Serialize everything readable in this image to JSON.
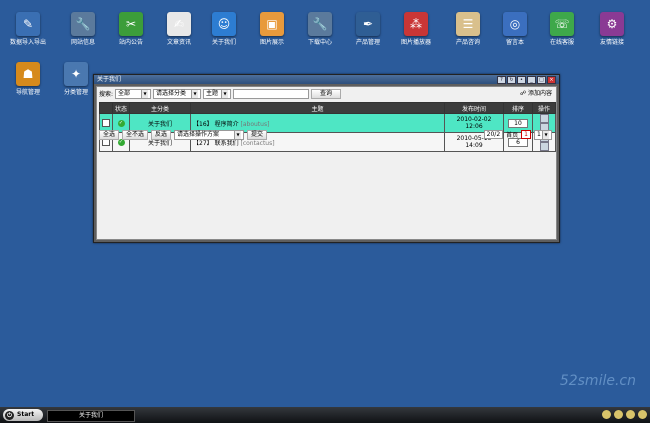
{
  "desktop_icons": [
    {
      "label": "数据导入导出",
      "icon": "data-import-export-icon",
      "color": "#3a6fb3",
      "glyph": "✎"
    },
    {
      "label": "网站信息",
      "icon": "wrench-icon",
      "color": "#5b7a9c",
      "glyph": "🔧"
    },
    {
      "label": "站内公告",
      "icon": "tools-icon",
      "color": "#3c9d3a",
      "glyph": "✂"
    },
    {
      "label": "文章资讯",
      "icon": "notepad-icon",
      "color": "#e8e8e8",
      "glyph": "✍"
    },
    {
      "label": "关于我们",
      "icon": "accessibility-icon",
      "color": "#2d7dd2",
      "glyph": "☺"
    },
    {
      "label": "图片展示",
      "icon": "picture-icon",
      "color": "#e89a3c",
      "glyph": "▣"
    },
    {
      "label": "下载中心",
      "icon": "download-tools-icon",
      "color": "#5b7a9c",
      "glyph": "🔧"
    },
    {
      "label": "产品管理",
      "icon": "pen-tool-icon",
      "color": "#2f5e94",
      "glyph": "✒"
    },
    {
      "label": "图片播放器",
      "icon": "dice-icon",
      "color": "#c93636",
      "glyph": "⁂"
    },
    {
      "label": "产品咨询",
      "icon": "clipboard-icon",
      "color": "#d9c08c",
      "glyph": "☰"
    },
    {
      "label": "留言本",
      "icon": "globe-icon",
      "color": "#3b6fbf",
      "glyph": "◎"
    },
    {
      "label": "在线客服",
      "icon": "chat-icon",
      "color": "#3ea84a",
      "glyph": "☏"
    },
    {
      "label": "友情链接",
      "icon": "gear-icon",
      "color": "#8a3a94",
      "glyph": "⚙"
    },
    {
      "label": "导航管理",
      "icon": "users-icon",
      "color": "#d68a1c",
      "glyph": "☗"
    },
    {
      "label": "分类管理",
      "icon": "category-icon",
      "color": "#4a78b0",
      "glyph": "✦"
    }
  ],
  "window": {
    "title": "关于我们",
    "search_label": "搜索:",
    "filter_all": "全部",
    "filter_category": "请选择分类",
    "filter_field": "主题",
    "search_button": "查询",
    "add_link": "添加内容",
    "columns": [
      "状态",
      "主分类",
      "主题",
      "发布时间",
      "排序",
      "操作"
    ],
    "rows": [
      {
        "category": "关于我们",
        "id": "【16】",
        "title": "程序简介",
        "slug": "[aboutus]",
        "date": "2010-02-02 12:06",
        "order": "10"
      },
      {
        "category": "关于我们",
        "id": "【27】",
        "title": "联系我们",
        "slug": "[contactus]",
        "date": "2010-05-15 14:09",
        "order": "6"
      }
    ],
    "select_all": "全选",
    "select_none": "全不选",
    "invert": "反选",
    "action_placeholder": "请选择操作方案",
    "submit": "提交",
    "page_info": "20/2",
    "first_page": "首页",
    "current_page": "1",
    "page_select": "1"
  },
  "taskbar": {
    "start": "Start",
    "task": "关于我们"
  },
  "watermark": "52smile.cn"
}
